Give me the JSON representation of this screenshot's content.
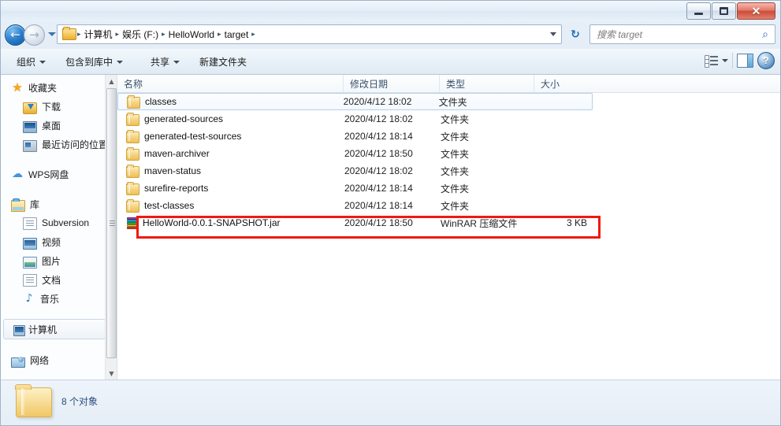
{
  "window": {
    "buttons": {
      "minimize": "minimize",
      "maximize": "maximize",
      "close": "✕"
    }
  },
  "addressbar": {
    "back_glyph": "←",
    "forward_glyph": "→",
    "separator": "▸",
    "crumbs": [
      "计算机",
      "娱乐 (F:)",
      "HelloWorld",
      "target"
    ],
    "refresh_glyph": "↻",
    "search_placeholder": "搜索 target",
    "search_icon_glyph": "⌕"
  },
  "toolbar": {
    "organize": "组织",
    "include_in_library": "包含到库中",
    "share": "共享",
    "new_folder": "新建文件夹",
    "help_glyph": "?"
  },
  "sidebar": {
    "items": [
      {
        "label": "收藏夹",
        "icon": "star-icon",
        "level": "root"
      },
      {
        "label": "下载",
        "icon": "downloads-icon",
        "level": "child"
      },
      {
        "label": "桌面",
        "icon": "desktop-icon",
        "level": "child"
      },
      {
        "label": "最近访问的位置",
        "icon": "recent-places-icon",
        "level": "child"
      },
      {
        "label": "WPS网盘",
        "icon": "cloud-icon",
        "level": "root"
      },
      {
        "label": "库",
        "icon": "library-icon",
        "level": "root"
      },
      {
        "label": "Subversion",
        "icon": "document-icon",
        "level": "child"
      },
      {
        "label": "视频",
        "icon": "video-icon",
        "level": "child"
      },
      {
        "label": "图片",
        "icon": "picture-icon",
        "level": "child"
      },
      {
        "label": "文档",
        "icon": "document-icon",
        "level": "child"
      },
      {
        "label": "音乐",
        "icon": "music-icon",
        "level": "child"
      },
      {
        "label": "计算机",
        "icon": "computer-icon",
        "level": "root",
        "selected": true
      },
      {
        "label": "网络",
        "icon": "network-icon",
        "level": "root"
      }
    ]
  },
  "filelist": {
    "columns": [
      "名称",
      "修改日期",
      "类型",
      "大小"
    ],
    "rows": [
      {
        "name": "classes",
        "date": "2020/4/12 18:02",
        "type": "文件夹",
        "size": "",
        "icon": "folder-icon",
        "focused": true
      },
      {
        "name": "generated-sources",
        "date": "2020/4/12 18:02",
        "type": "文件夹",
        "size": "",
        "icon": "folder-icon"
      },
      {
        "name": "generated-test-sources",
        "date": "2020/4/12 18:14",
        "type": "文件夹",
        "size": "",
        "icon": "folder-icon"
      },
      {
        "name": "maven-archiver",
        "date": "2020/4/12 18:50",
        "type": "文件夹",
        "size": "",
        "icon": "folder-icon"
      },
      {
        "name": "maven-status",
        "date": "2020/4/12 18:02",
        "type": "文件夹",
        "size": "",
        "icon": "folder-icon"
      },
      {
        "name": "surefire-reports",
        "date": "2020/4/12 18:14",
        "type": "文件夹",
        "size": "",
        "icon": "folder-icon"
      },
      {
        "name": "test-classes",
        "date": "2020/4/12 18:14",
        "type": "文件夹",
        "size": "",
        "icon": "folder-icon"
      },
      {
        "name": "HelloWorld-0.0.1-SNAPSHOT.jar",
        "date": "2020/4/12 18:50",
        "type": "WinRAR 压缩文件",
        "size": "3 KB",
        "icon": "winrar-archive-icon",
        "highlighted": true
      }
    ],
    "highlight_color": "#f01a0f"
  },
  "statusbar": {
    "text": "8 个对象"
  }
}
